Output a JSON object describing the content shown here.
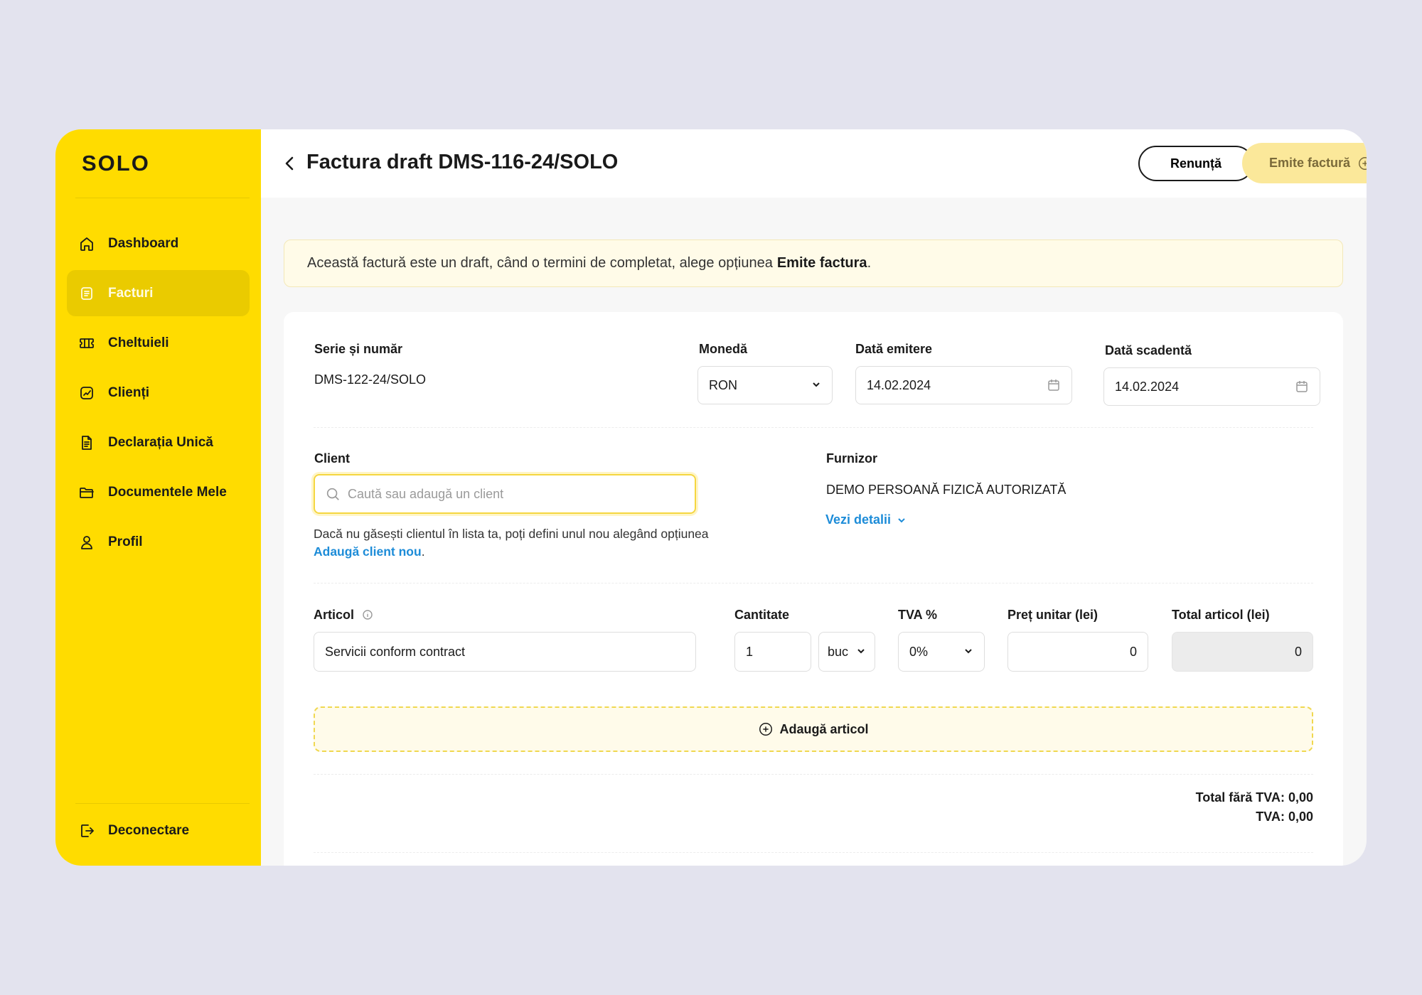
{
  "app": {
    "logo": "SOLO"
  },
  "sidebar": {
    "items": [
      {
        "label": "Dashboard",
        "icon": "home-icon"
      },
      {
        "label": "Facturi",
        "icon": "invoice-icon",
        "active": true
      },
      {
        "label": "Cheltuieli",
        "icon": "ticket-icon"
      },
      {
        "label": "Clienți",
        "icon": "chart-icon"
      },
      {
        "label": "Declarația Unică",
        "icon": "document-icon"
      },
      {
        "label": "Documentele Mele",
        "icon": "folder-icon"
      },
      {
        "label": "Profil",
        "icon": "user-icon"
      }
    ],
    "logout_label": "Deconectare"
  },
  "header": {
    "title": "Factura draft DMS-116-24/SOLO",
    "cancel_label": "Renunță",
    "emit_label": "Emite factură"
  },
  "notice": {
    "text": "Această factură este un draft, când o termini de completat, alege opțiunea",
    "bold": "Emite factura",
    "end": "."
  },
  "form": {
    "series_label": "Serie și număr",
    "series_value": "DMS-122-24/SOLO",
    "currency_label": "Monedă",
    "currency_value": "RON",
    "issue_date_label": "Dată emitere",
    "issue_date_value": "14.02.2024",
    "due_date_label": "Dată scadentă",
    "due_date_value": "14.02.2024",
    "client_label": "Client",
    "client_placeholder": "Caută sau adaugă un client",
    "client_hint": "Dacă nu găsești clientul în lista ta, poți defini unul nou alegând opțiunea",
    "client_hint_link": "Adaugă client nou",
    "client_hint_end": ".",
    "supplier_label": "Furnizor",
    "supplier_value": "DEMO PERSOANĂ FIZICĂ AUTORIZATĂ",
    "supplier_details": "Vezi detalii"
  },
  "article": {
    "article_label": "Articol",
    "article_value": "Servicii conform contract",
    "quantity_label": "Cantitate",
    "quantity_value": "1",
    "unit_value": "buc",
    "vat_label": "TVA %",
    "vat_value": "0%",
    "unit_price_label": "Preț unitar (lei)",
    "unit_price_value": "0",
    "total_label": "Total articol (lei)",
    "total_value": "0",
    "add_label": "Adaugă articol"
  },
  "totals": {
    "without_vat": "Total fără TVA: 0,00",
    "vat": "TVA: 0,00"
  },
  "colors": {
    "accent": "#ffdc00",
    "link": "#1d8cd8",
    "emit_button": "#fbe89a"
  }
}
